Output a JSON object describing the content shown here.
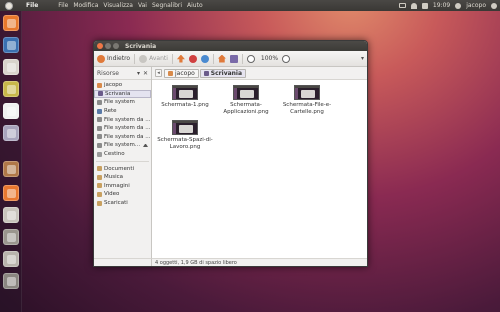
{
  "panel": {
    "app_name": "File",
    "menus": [
      "File",
      "Modifica",
      "Visualizza",
      "Vai",
      "Segnalibri",
      "Aiuto"
    ],
    "time": "19:09",
    "user": "jacopo"
  },
  "launcher": {
    "items": [
      {
        "name": "firefox",
        "color": "#e8782c"
      },
      {
        "name": "thunderbird",
        "color": "#3a6fb0"
      },
      {
        "name": "files",
        "color": "#d8d4cc"
      },
      {
        "name": "shotwell",
        "color": "#c8b84a"
      },
      {
        "name": "libreoffice",
        "color": "#f0f0f0"
      },
      {
        "name": "settings",
        "color": "#a8a4bc"
      },
      {
        "name": "software-center",
        "color": "#b07848"
      },
      {
        "name": "nautilus-active",
        "color": "#e87830"
      },
      {
        "name": "workspaces",
        "color": "#c8c4bc"
      },
      {
        "name": "tools",
        "color": "#9a968e"
      },
      {
        "name": "usb",
        "color": "#b8b4ac"
      },
      {
        "name": "trash",
        "color": "#8a8680"
      }
    ]
  },
  "window": {
    "title": "Scrivania",
    "toolbar": {
      "back_label": "Indietro",
      "forward_label": "Avanti",
      "zoom": "100%"
    },
    "sidebar": {
      "header": "Risorse",
      "items": [
        {
          "label": "jacopo",
          "icon": "home-icon",
          "color": "#d88a4a"
        },
        {
          "label": "Scrivania",
          "icon": "desktop-icon",
          "color": "#6a5a8a",
          "selected": true
        },
        {
          "label": "File system",
          "icon": "drive-icon",
          "color": "#8a8a8a"
        },
        {
          "label": "Rete",
          "icon": "network-icon",
          "color": "#5a7aa8"
        },
        {
          "label": "File system da ...",
          "icon": "drive-icon",
          "color": "#8a8a8a"
        },
        {
          "label": "File system da ...",
          "icon": "drive-icon",
          "color": "#8a8a8a"
        },
        {
          "label": "File system da ...",
          "icon": "drive-icon",
          "color": "#8a8a8a"
        },
        {
          "label": "File system...",
          "icon": "drive-icon",
          "color": "#8a8a8a",
          "eject": true
        },
        {
          "label": "Cestino",
          "icon": "trash-icon",
          "color": "#9a9a9a"
        }
      ],
      "bookmarks": [
        {
          "label": "Documenti",
          "icon": "folder-icon",
          "color": "#c8a060"
        },
        {
          "label": "Musica",
          "icon": "folder-icon",
          "color": "#c8a060"
        },
        {
          "label": "Immagini",
          "icon": "folder-icon",
          "color": "#c8a060"
        },
        {
          "label": "Video",
          "icon": "folder-icon",
          "color": "#c8a060"
        },
        {
          "label": "Scaricati",
          "icon": "folder-icon",
          "color": "#c8a060"
        }
      ]
    },
    "pathbar": {
      "crumbs": [
        {
          "label": "jacopo",
          "color": "#d88a4a"
        },
        {
          "label": "Scrivania",
          "color": "#6a5a8a",
          "active": true
        }
      ]
    },
    "files": [
      {
        "line1": "Schermata-1.png",
        "line2": ""
      },
      {
        "line1": "Schermata-",
        "line2": "Applicazioni.png"
      },
      {
        "line1": "Schermata-File-e-",
        "line2": "Cartelle.png"
      },
      {
        "line1": "Schermata-Spazi-di-",
        "line2": "Lavoro.png"
      }
    ],
    "status": "4 oggetti, 1,9 GB di spazio libero"
  }
}
